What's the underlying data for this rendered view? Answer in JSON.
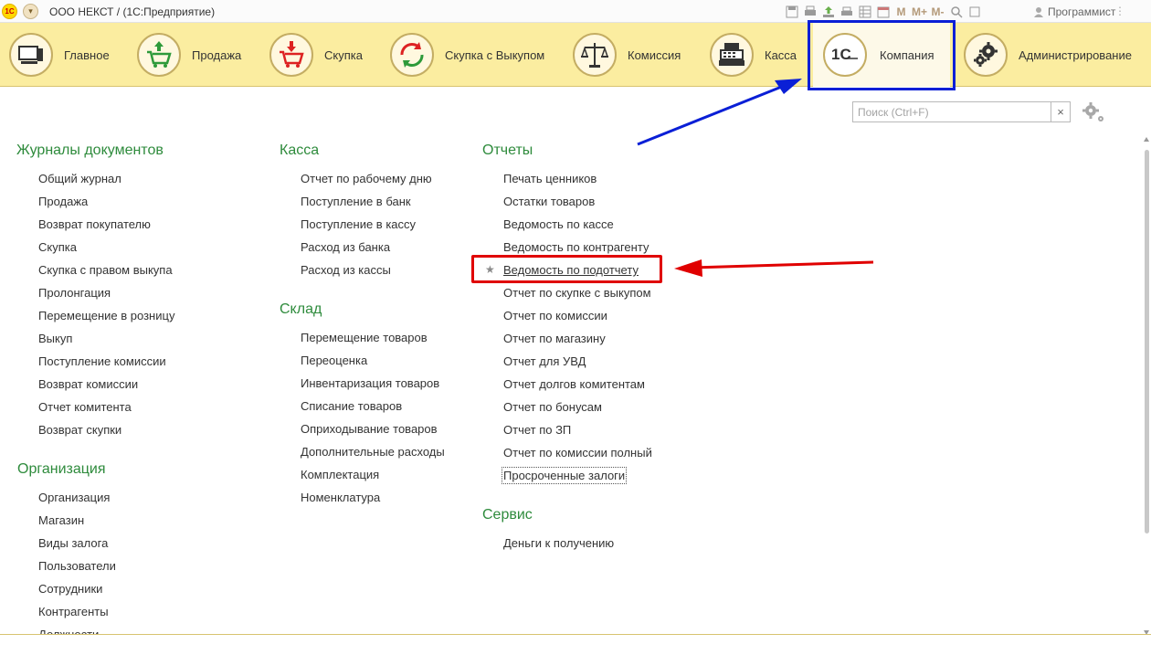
{
  "titlebar": {
    "title": "ООО НЕКСТ /  (1С:Предприятие)",
    "user": "Программист",
    "m_labels": [
      "M",
      "M+",
      "M-"
    ]
  },
  "sections": [
    {
      "label": "Главное",
      "icon": "computer-icon"
    },
    {
      "label": "Продажа",
      "icon": "cart-up-icon"
    },
    {
      "label": "Скупка",
      "icon": "cart-down-icon"
    },
    {
      "label": "Скупка с Выкупом",
      "icon": "cycle-arrows-icon"
    },
    {
      "label": "Комиссия",
      "icon": "scales-icon"
    },
    {
      "label": "Касса",
      "icon": "cash-register-icon"
    },
    {
      "label": "Компания",
      "icon": "1c-logo-icon"
    },
    {
      "label": "Администрирование",
      "icon": "gears-icon"
    }
  ],
  "search": {
    "placeholder": "Поиск (Ctrl+F)",
    "clear": "×"
  },
  "groups": {
    "journals": {
      "title": "Журналы документов",
      "items": [
        "Общий журнал",
        "Продажа",
        "Возврат покупателю",
        "Скупка",
        "Скупка с правом выкупа",
        "Пролонгация",
        "Перемещение в розницу",
        "Выкуп",
        "Поступление комиссии",
        "Возврат комиссии",
        "Отчет комитента",
        "Возврат скупки"
      ]
    },
    "organization": {
      "title": "Организация",
      "items": [
        "Организация",
        "Магазин",
        "Виды залога",
        "Пользователи",
        "Сотрудники",
        "Контрагенты",
        "Должности"
      ]
    },
    "kassa": {
      "title": "Касса",
      "items": [
        "Отчет по рабочему дню",
        "Поступление в банк",
        "Поступление в кассу",
        "Расход из банка",
        "Расход из кассы"
      ]
    },
    "sklad": {
      "title": "Склад",
      "items": [
        "Перемещение товаров",
        "Переоценка",
        "Инвентаризация товаров",
        "Списание товаров",
        "Оприходывание товаров",
        "Дополнительные расходы",
        "Комплектация",
        "Номенклатура"
      ]
    },
    "reports": {
      "title": "Отчеты",
      "items": [
        "Печать ценников",
        "Остатки товаров",
        "Ведомость по кассе",
        "Ведомость по контрагенту",
        "Ведомость по подотчету",
        "Отчет по скупке с выкупом",
        "Отчет по комиссии",
        "Отчет по магазину",
        "Отчет для УВД",
        "Отчет долгов комитентам",
        "Отчет по бонусам",
        "Отчет по ЗП",
        "Отчет по комиссии полный",
        "Просроченные залоги"
      ]
    },
    "service": {
      "title": "Сервис",
      "items": [
        "Деньги к получению"
      ]
    }
  },
  "colors": {
    "sections_bg": "#fbeda0",
    "group_title": "#2e8b3c",
    "annotation_blue": "#0a1fd6",
    "annotation_red": "#e00000"
  }
}
